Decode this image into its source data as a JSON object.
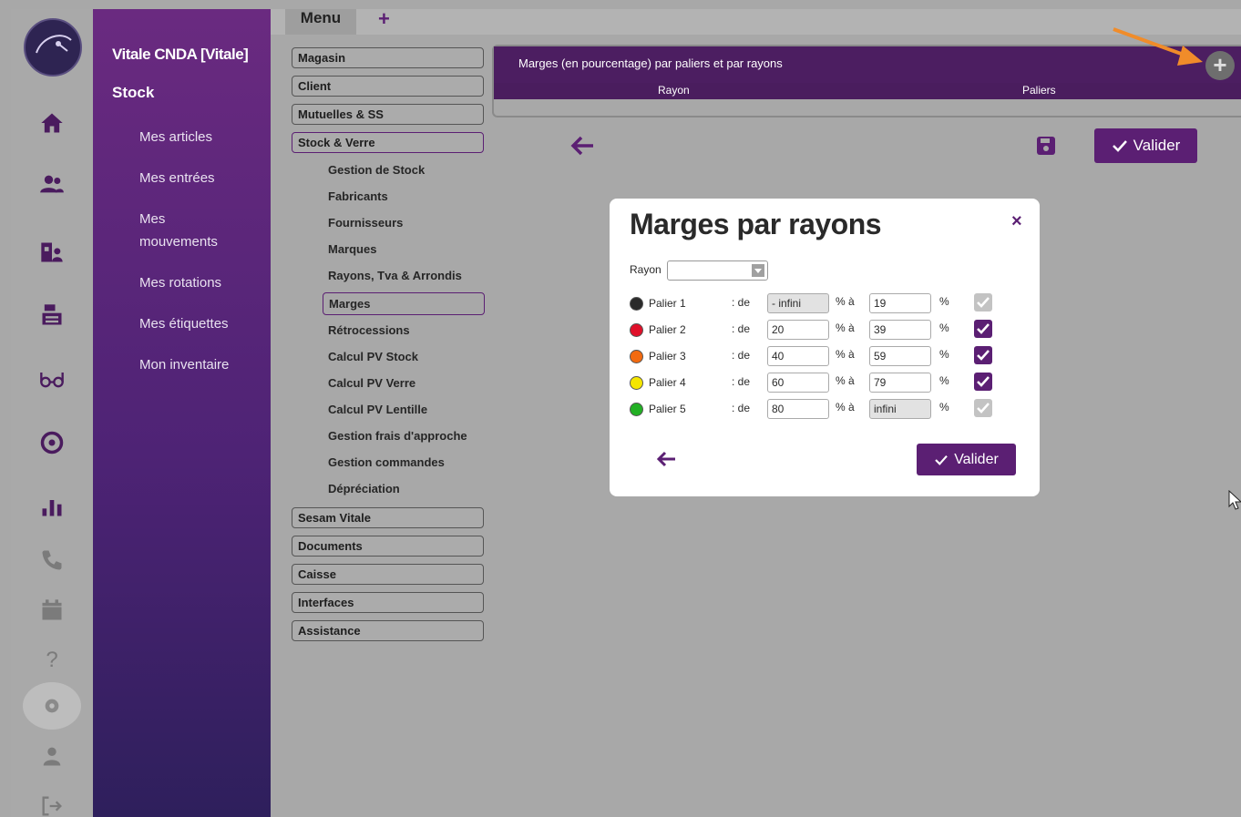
{
  "sidebar": {
    "title": "Vitale CNDA [Vitale]",
    "section": "Stock",
    "items": [
      "Mes articles",
      "Mes entrées",
      "Mes mouvements",
      "Mes rotations",
      "Mes étiquettes",
      "Mon inventaire"
    ]
  },
  "rail_icons": [
    "home-icon",
    "users-icon",
    "patient-icon",
    "cash-register-icon",
    "glasses-icon",
    "eye-icon",
    "chart-icon",
    "phone-icon",
    "calendar-icon",
    "help-icon",
    "settings-icon",
    "user-icon",
    "logout-icon"
  ],
  "tabs": {
    "menu": "Menu",
    "add": "+"
  },
  "menu": {
    "sections_top": [
      "Magasin",
      "Client",
      "Mutuelles & SS",
      "Stock & Verre"
    ],
    "stock_sub": [
      "Gestion de Stock",
      "Fabricants",
      "Fournisseurs",
      "Marques",
      "Rayons, Tva & Arrondis",
      "Marges",
      "Rétrocessions",
      "Calcul PV Stock",
      "Calcul PV Verre",
      "Calcul PV Lentille",
      "Gestion frais d'approche",
      "Gestion commandes",
      "Dépréciation"
    ],
    "sections_bottom": [
      "Sesam Vitale",
      "Documents",
      "Caisse",
      "Interfaces",
      "Assistance"
    ]
  },
  "panel": {
    "title": "Marges (en pourcentage) par paliers et par rayons",
    "col_rayon": "Rayon",
    "col_paliers": "Paliers",
    "add_label": "+"
  },
  "actions": {
    "valider": "Valider"
  },
  "modal": {
    "title": "Marges par rayons",
    "close": "×",
    "rayon_label": "Rayon",
    "rayon_value": "",
    "de_label": ": de",
    "a_label": "% à",
    "pct_label": "%",
    "valider": "Valider",
    "paliers": [
      {
        "name": "Palier 1",
        "color": "#2a2a2a",
        "from": "- infini",
        "to": "19",
        "from_disabled": true,
        "to_disabled": false,
        "checked": true,
        "check_disabled": true
      },
      {
        "name": "Palier 2",
        "color": "#e0102a",
        "from": "20",
        "to": "39",
        "from_disabled": false,
        "to_disabled": false,
        "checked": true,
        "check_disabled": false
      },
      {
        "name": "Palier 3",
        "color": "#f26a10",
        "from": "40",
        "to": "59",
        "from_disabled": false,
        "to_disabled": false,
        "checked": true,
        "check_disabled": false
      },
      {
        "name": "Palier 4",
        "color": "#f5e600",
        "from": "60",
        "to": "79",
        "from_disabled": false,
        "to_disabled": false,
        "checked": true,
        "check_disabled": false
      },
      {
        "name": "Palier 5",
        "color": "#22b024",
        "from": "80",
        "to": "infini",
        "from_disabled": false,
        "to_disabled": true,
        "checked": true,
        "check_disabled": true
      }
    ]
  },
  "colors": {
    "brand": "#5b1f73",
    "annotation": "#f08c2a"
  }
}
